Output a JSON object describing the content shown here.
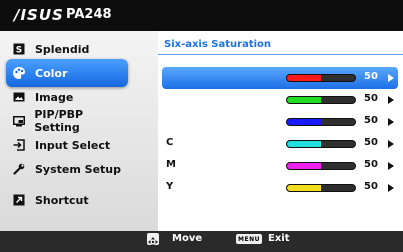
{
  "header": {
    "logo": "/ISUS",
    "model": "PA248"
  },
  "sidebar": {
    "items": [
      {
        "label": "Splendid",
        "icon": "splendid-icon",
        "active": false
      },
      {
        "label": "Color",
        "icon": "palette-icon",
        "active": true
      },
      {
        "label": "Image",
        "icon": "image-icon",
        "active": false
      },
      {
        "label": "PIP/PBP Setting",
        "icon": "pip-icon",
        "active": false
      },
      {
        "label": "Input Select",
        "icon": "input-icon",
        "active": false
      },
      {
        "label": "System Setup",
        "icon": "wrench-icon",
        "active": false
      },
      {
        "label": "Shortcut",
        "icon": "shortcut-icon",
        "active": false
      }
    ]
  },
  "content": {
    "title": "Six-axis Saturation",
    "rows": [
      {
        "label": "",
        "value": "50",
        "level": 0.5,
        "color": "#ff1a1a",
        "active": true
      },
      {
        "label": "",
        "value": "50",
        "level": 0.5,
        "color": "#22dd22",
        "active": false
      },
      {
        "label": "",
        "value": "50",
        "level": 0.5,
        "color": "#1a1aff",
        "active": false
      },
      {
        "label": "C",
        "value": "50",
        "level": 0.5,
        "color": "#22e0e0",
        "active": false
      },
      {
        "label": "M",
        "value": "50",
        "level": 0.5,
        "color": "#ee22ee",
        "active": false
      },
      {
        "label": "Y",
        "value": "50",
        "level": 0.5,
        "color": "#f2e020",
        "active": false
      }
    ]
  },
  "footer": {
    "move_label": "Move",
    "menu_key": "MENU",
    "exit_label": "Exit"
  },
  "colors": {
    "accent": "#1668e0",
    "title": "#1a73e8"
  }
}
